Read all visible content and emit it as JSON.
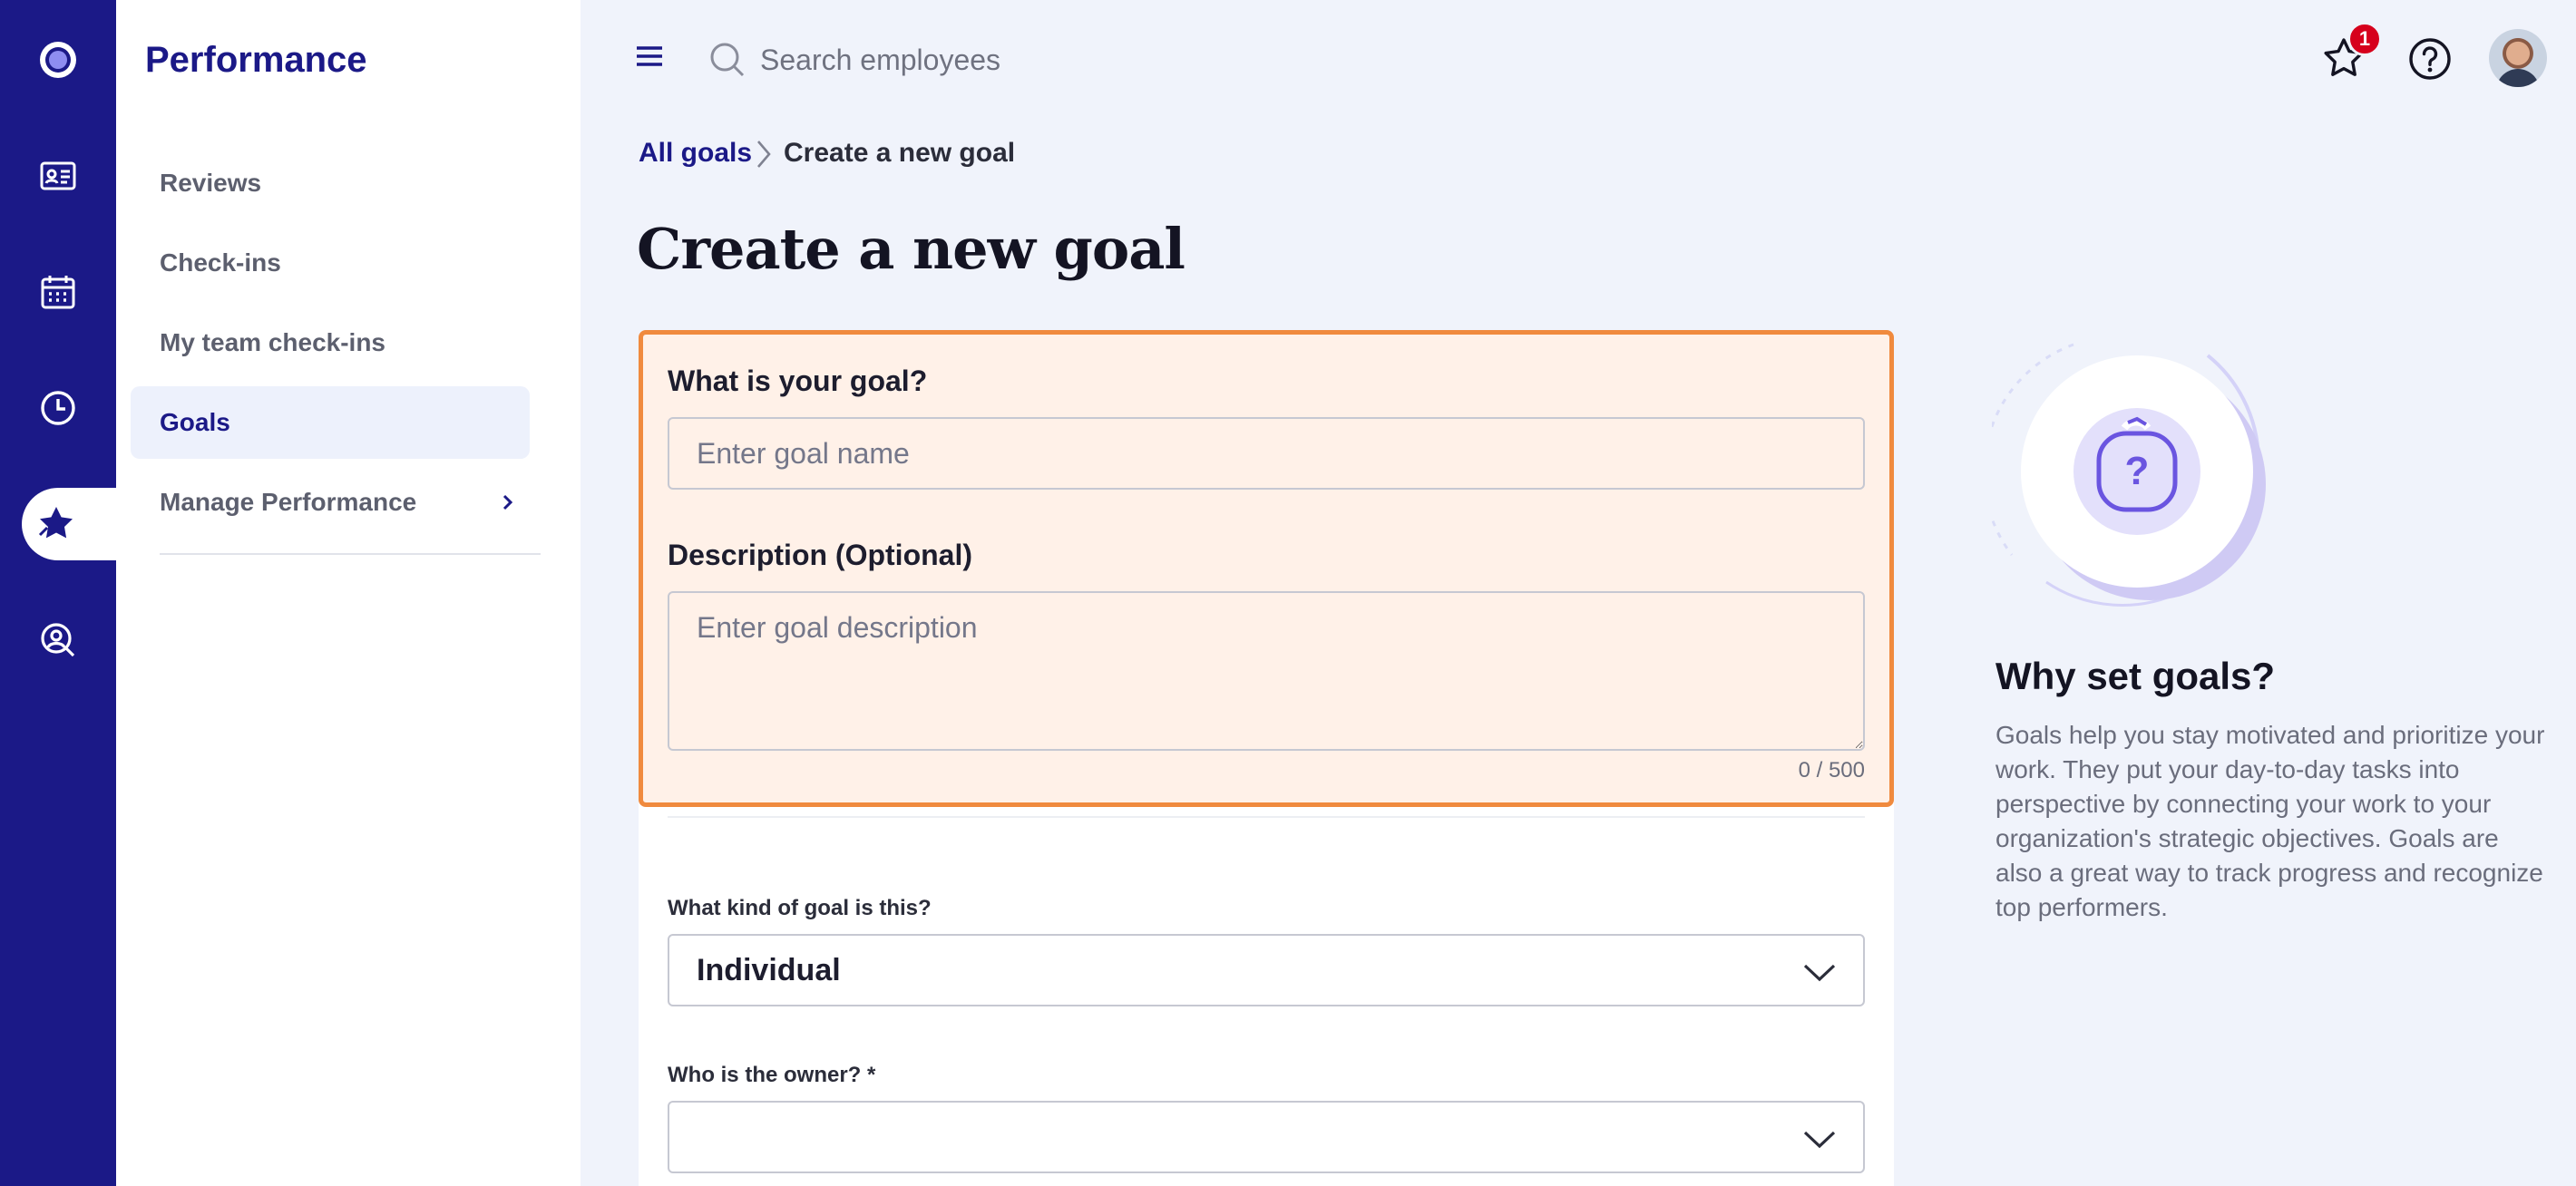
{
  "rail": {
    "items": [
      {
        "name": "logo-icon"
      },
      {
        "name": "id-card-icon"
      },
      {
        "name": "calendar-icon"
      },
      {
        "name": "clock-icon"
      },
      {
        "name": "performance-star-icon",
        "active": true
      },
      {
        "name": "people-search-icon"
      }
    ]
  },
  "sidebar": {
    "title": "Performance",
    "items": [
      {
        "label": "Reviews"
      },
      {
        "label": "Check-ins"
      },
      {
        "label": "My team check-ins"
      },
      {
        "label": "Goals",
        "active": true
      },
      {
        "label": "Manage Performance",
        "has_submenu": true
      }
    ]
  },
  "topbar": {
    "search_placeholder": "Search employees",
    "notification_count": "1"
  },
  "breadcrumb": {
    "parent": "All goals",
    "current": "Create a new goal"
  },
  "page": {
    "title": "Create a new goal"
  },
  "form": {
    "goal_label": "What is your goal?",
    "goal_placeholder": "Enter goal name",
    "goal_value": "",
    "description_label": "Description (Optional)",
    "description_placeholder": "Enter goal description",
    "description_value": "",
    "char_counter": "0 / 500",
    "kind_label": "What kind of goal is this?",
    "kind_value": "Individual",
    "owner_label": "Who is the owner? *",
    "owner_value": ""
  },
  "side_panel": {
    "title": "Why set goals?",
    "body": "Goals help you stay motivated and prioritize your work. They put your day-to-day tasks into perspective by connecting your work to your organization's strategic objectives. Goals are also a great way to track progress and recognize top performers."
  },
  "colors": {
    "rail_bg": "#1b1987",
    "accent": "#1b1987",
    "highlight_border": "#f08a3e",
    "highlight_fill": "#fff1e8",
    "badge": "#d6001c",
    "page_bg": "#f0f3fb"
  }
}
